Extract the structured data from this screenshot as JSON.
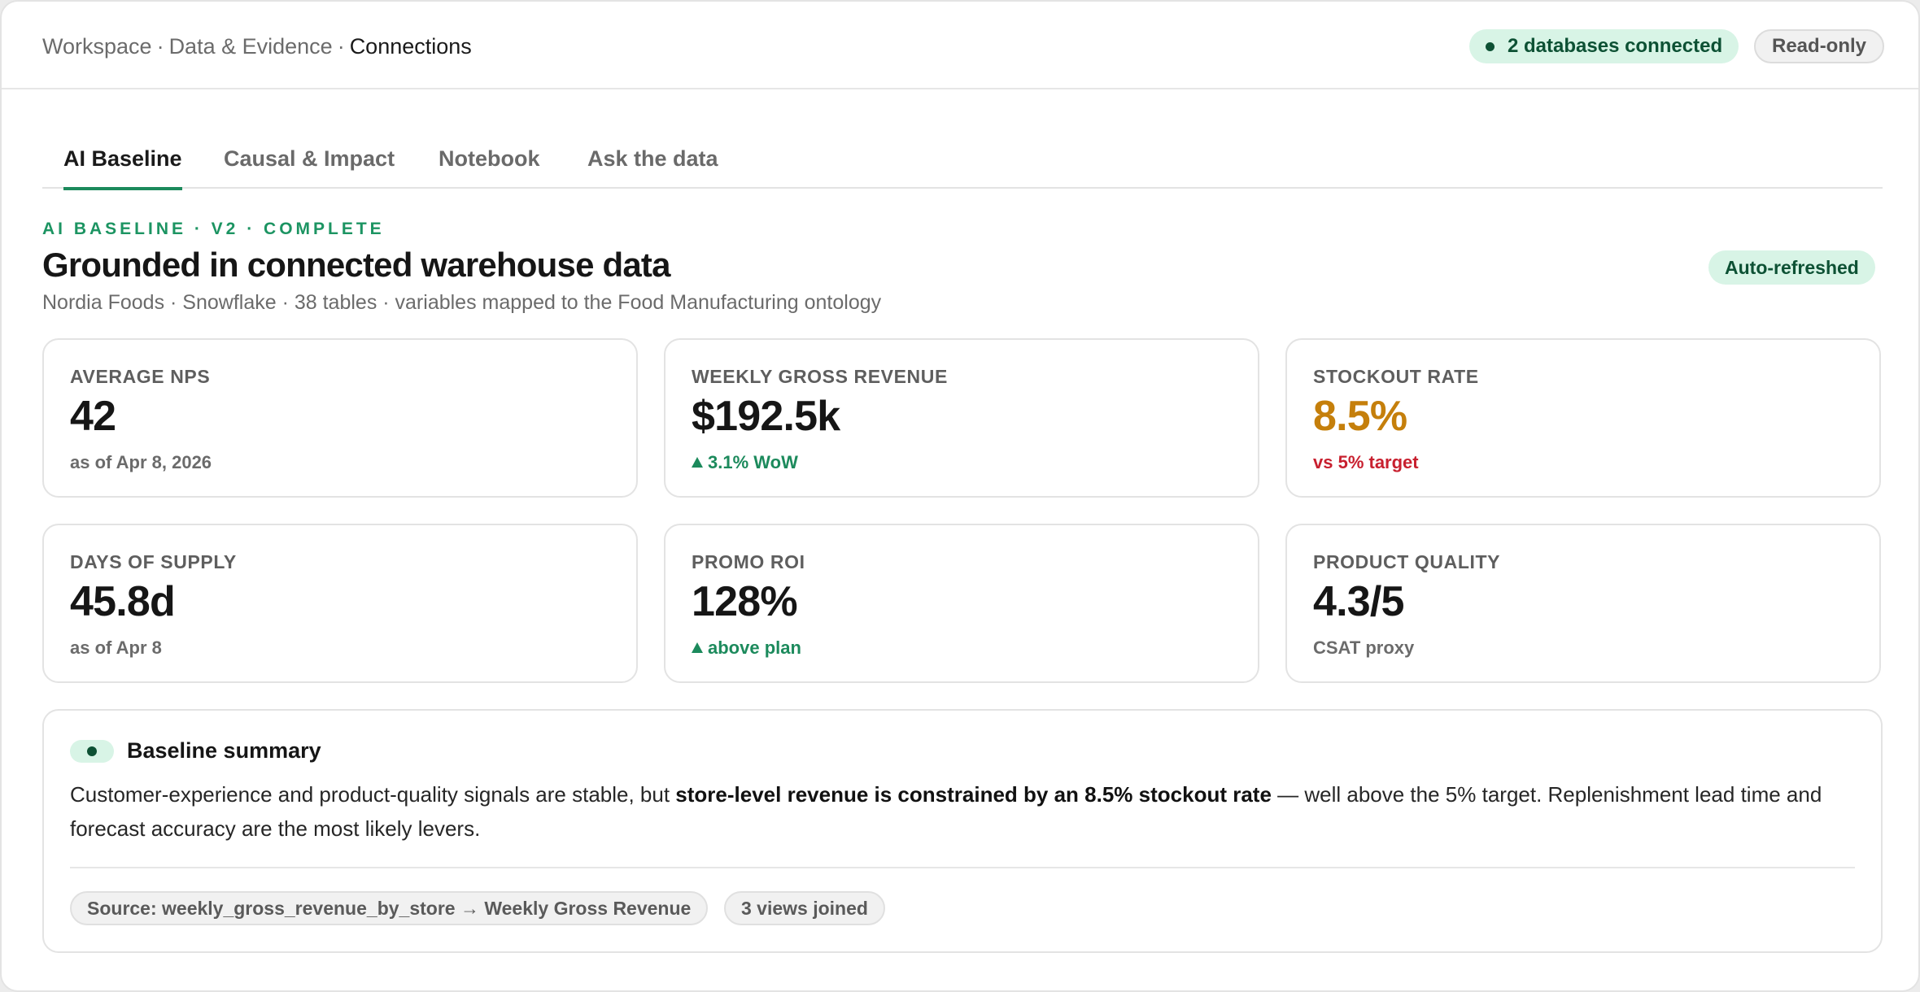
{
  "breadcrumb": {
    "items": [
      "Workspace",
      "Data & Evidence"
    ],
    "separator": "·",
    "current": "Connections"
  },
  "status": {
    "connected_label": "2 databases connected",
    "readonly_label": "Read-only"
  },
  "tabs": [
    {
      "label": "AI Baseline",
      "active": true
    },
    {
      "label": "Causal & Impact",
      "active": false
    },
    {
      "label": "Notebook",
      "active": false
    },
    {
      "label": "Ask the data",
      "active": false
    }
  ],
  "section": {
    "eyebrow": "AI BASELINE · V2 · COMPLETE",
    "title": "Grounded in connected warehouse data",
    "subtitle": "Nordia Foods · Snowflake · 38 tables · variables mapped to the Food Manufacturing ontology",
    "badge": "Auto-refreshed"
  },
  "metrics": [
    {
      "label": "AVERAGE NPS",
      "value": "42",
      "note": "as of Apr 8, 2026"
    },
    {
      "label": "WEEKLY GROSS REVENUE",
      "value": "$192.5k",
      "note": "3.1% WoW"
    },
    {
      "label": "STOCKOUT RATE",
      "value": "8.5%",
      "note": "vs 5% target"
    },
    {
      "label": "DAYS OF SUPPLY",
      "value": "45.8d",
      "note": "as of Apr 8"
    },
    {
      "label": "PROMO ROI",
      "value": "128%",
      "note": "above plan"
    },
    {
      "label": "PRODUCT QUALITY",
      "value": "4.3/5",
      "note": "CSAT proxy"
    }
  ],
  "colors": {
    "accent": "#1c8a5c",
    "positive": "#1c8a5c",
    "warning": "#c57f0b",
    "negative": "#c8202f",
    "badge_bg": "#d8f4e6"
  },
  "summary": {
    "title": "Baseline summary",
    "text_before": "Customer-experience and product-quality signals are stable, but ",
    "text_bold": "store-level revenue is constrained by an 8.5% stockout rate",
    "text_after": " — well above the 5% target. Replenishment lead time and forecast accuracy are the most likely levers.",
    "chips": [
      "Source: weekly_gross_revenue_by_store → Weekly Gross Revenue",
      "3 views joined"
    ]
  }
}
